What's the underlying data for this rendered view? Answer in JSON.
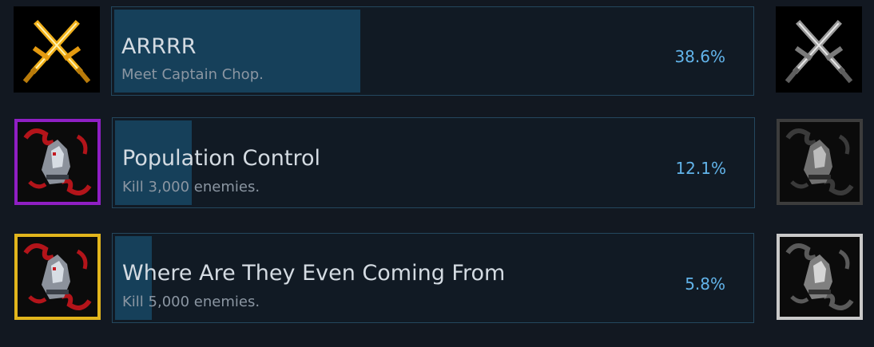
{
  "colors": {
    "background": "#121821",
    "panel": "#111a24",
    "panel_border": "#24475e",
    "progress_fill": "#16405a",
    "title_text": "#d4dbe2",
    "desc_text": "#8b96a2",
    "percent_text": "#62b4ea"
  },
  "achievements": [
    {
      "title": "ARRRR",
      "description": "Meet Captain Chop.",
      "percent_label": "38.6%",
      "percent": 38.6,
      "icon": "crossed-swords-gold-icon",
      "locked_icon": "crossed-swords-grey-icon",
      "frame_color": "#000000"
    },
    {
      "title": "Population Control",
      "description": "Kill 3,000 enemies.",
      "percent_label": "12.1%",
      "percent": 12.1,
      "icon": "werewolf-purple-frame-icon",
      "locked_icon": "werewolf-grey-frame-icon",
      "frame_color": "#8f1fc4"
    },
    {
      "title": "Where Are They Even Coming From",
      "description": "Kill 5,000 enemies.",
      "percent_label": "5.8%",
      "percent": 5.8,
      "icon": "werewolf-gold-frame-icon",
      "locked_icon": "werewolf-silver-frame-icon",
      "frame_color": "#e2b51c"
    }
  ]
}
